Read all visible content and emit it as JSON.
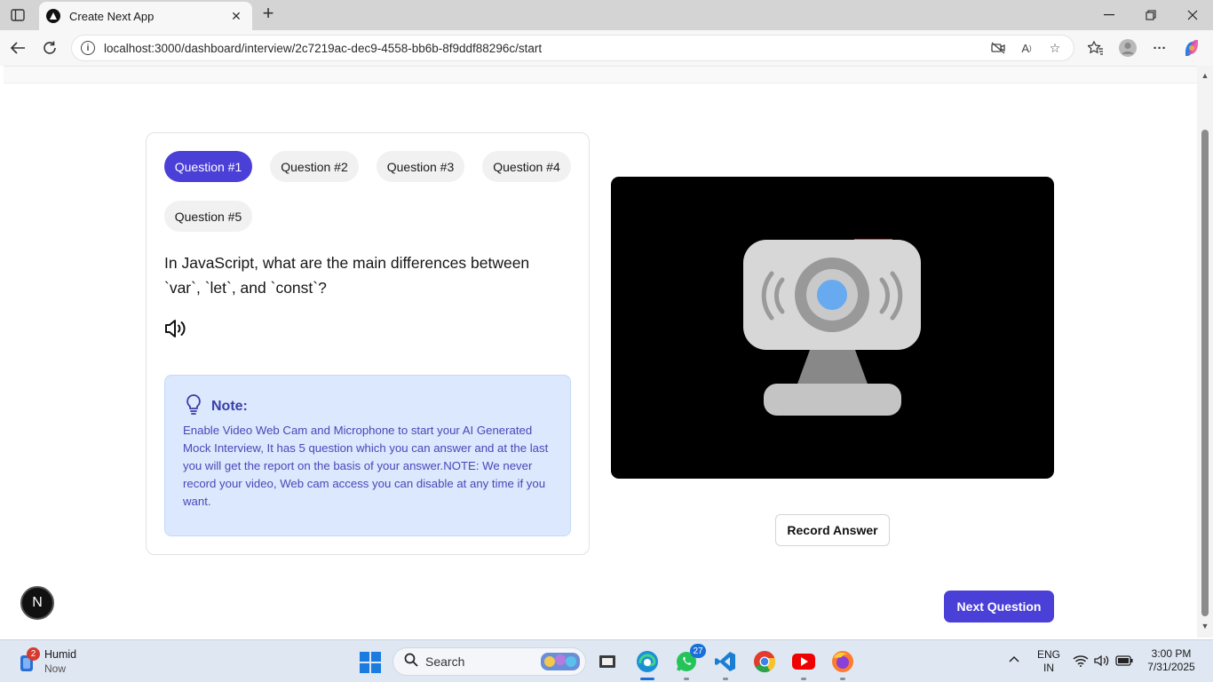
{
  "browser": {
    "tab_title": "Create Next App",
    "url": "localhost:3000/dashboard/interview/2c7219ac-dec9-4558-bb6b-8f9ddf88296c/start"
  },
  "interview": {
    "question_tabs": [
      "Question #1",
      "Question #2",
      "Question #3",
      "Question #4",
      "Question #5"
    ],
    "active_tab": "Question #1",
    "question_text": "In JavaScript, what are the main differences between `var`, `let`, and `const`?",
    "note": {
      "title": "Note:",
      "body": "Enable Video Web Cam and Microphone to start your AI Generated Mock Interview, It has 5 question which you can answer and at the last you will get the report on the basis of your answer.NOTE: We never record your video, Web cam access you can disable at any time if you want."
    },
    "record_button": "Record Answer",
    "next_button": "Next Question",
    "dev_badge": "N"
  },
  "taskbar": {
    "weather_title": "Humid",
    "weather_sub": "Now",
    "weather_badge": "2",
    "search_label": "Search",
    "whatsapp_count": "27",
    "lang_line1": "ENG",
    "lang_line2": "IN",
    "time": "3:00 PM",
    "date": "7/31/2025"
  },
  "colors": {
    "accent": "#4a3fd6",
    "note_bg": "#dbe8fd",
    "note_text": "#4a47b8"
  }
}
